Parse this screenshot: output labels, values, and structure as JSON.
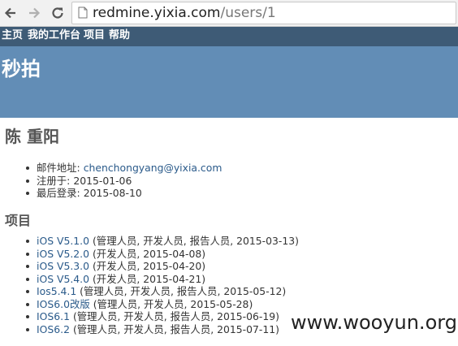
{
  "browser": {
    "url_host": "redmine.yixia.com",
    "url_path": "/users/1"
  },
  "top_menu": {
    "items": [
      "主页",
      "我的工作台",
      "项目",
      "帮助"
    ]
  },
  "header": {
    "title": "秒拍"
  },
  "user": {
    "name": "陈 重阳",
    "email_label": "邮件地址:",
    "email": "chenchongyang@yixia.com",
    "registered_label": "注册于:",
    "registered": "2015-01-06",
    "last_login_label": "最后登录:",
    "last_login": "2015-08-10"
  },
  "projects_heading": "项目",
  "projects": [
    {
      "name": "iOS V5.1.0",
      "detail": "(管理人员, 开发人员, 报告人员, 2015-03-13)"
    },
    {
      "name": "iOS V5.2.0",
      "detail": "(开发人员, 2015-04-08)"
    },
    {
      "name": "iOS V5.3.0",
      "detail": "(开发人员, 2015-04-20)"
    },
    {
      "name": "iOS V5.4.0",
      "detail": "(开发人员, 2015-04-21)"
    },
    {
      "name": "Ios5.4.1",
      "detail": "(管理人员, 开发人员, 报告人员, 2015-05-12)"
    },
    {
      "name": "IOS6.0改版",
      "detail": "(管理人员, 开发人员, 2015-05-28)"
    },
    {
      "name": "IOS6.1",
      "detail": "(管理人员, 开发人员, 报告人员, 2015-06-19)"
    },
    {
      "name": "IOS6.2",
      "detail": "(管理人员, 开发人员, 报告人员, 2015-07-11)"
    }
  ],
  "watermark": "www.wooyun.org",
  "colors": {
    "top_menu": "#3e5b76",
    "header": "#628db6",
    "link": "#2a5a8a"
  }
}
